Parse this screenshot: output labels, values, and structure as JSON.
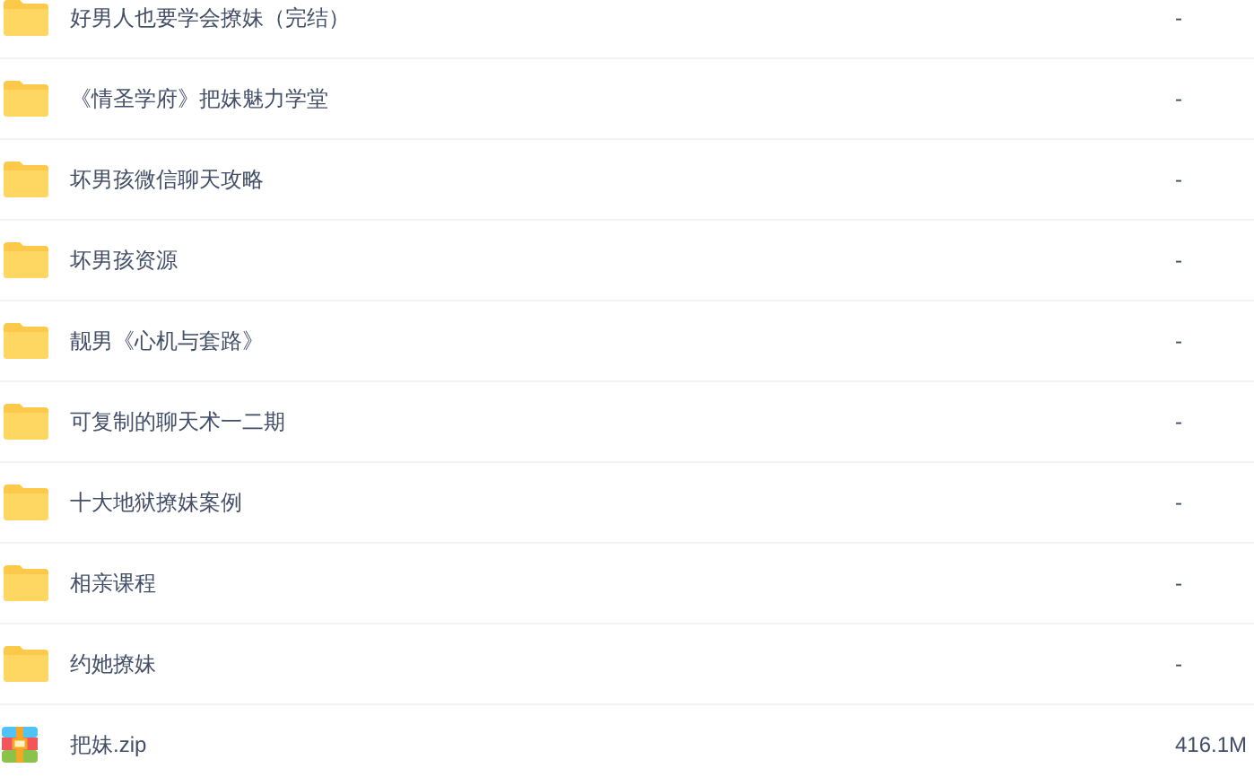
{
  "files": [
    {
      "kind": "folder",
      "name": "好男人也要学会撩妹（完结）",
      "size": "-"
    },
    {
      "kind": "folder",
      "name": "《情圣学府》把妹魅力学堂",
      "size": "-"
    },
    {
      "kind": "folder",
      "name": "坏男孩微信聊天攻略",
      "size": "-"
    },
    {
      "kind": "folder",
      "name": "坏男孩资源",
      "size": "-"
    },
    {
      "kind": "folder",
      "name": "靓男《心机与套路》",
      "size": "-"
    },
    {
      "kind": "folder",
      "name": "可复制的聊天术一二期",
      "size": "-"
    },
    {
      "kind": "folder",
      "name": "十大地狱撩妹案例",
      "size": "-"
    },
    {
      "kind": "folder",
      "name": "相亲课程",
      "size": "-"
    },
    {
      "kind": "folder",
      "name": "约她撩妹",
      "size": "-"
    },
    {
      "kind": "zip",
      "name": "把妹.zip",
      "size": "416.1M"
    }
  ]
}
